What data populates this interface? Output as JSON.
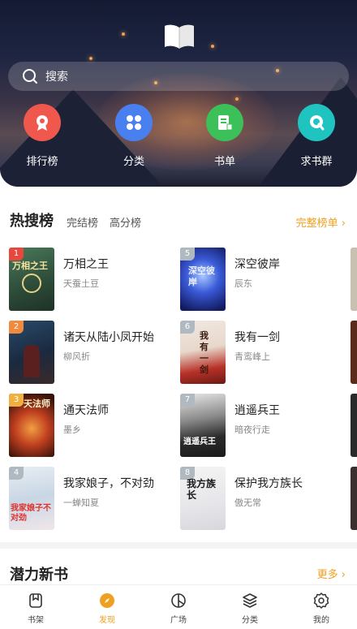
{
  "search": {
    "placeholder": "搜索"
  },
  "quick_links": [
    {
      "label": "排行榜",
      "icon": "ranking-badge-icon",
      "color": "#f0584e"
    },
    {
      "label": "分类",
      "icon": "category-grid-icon",
      "color": "#4a7ff0"
    },
    {
      "label": "书单",
      "icon": "booklist-icon",
      "color": "#3cc05a"
    },
    {
      "label": "求书群",
      "icon": "chat-bubble-icon",
      "color": "#1fc4c0"
    }
  ],
  "hot": {
    "title": "热搜榜",
    "tabs": [
      "完结榜",
      "高分榜"
    ],
    "more": "完整榜单 ›",
    "books": [
      {
        "rank": "1",
        "title": "万相之王",
        "author": "天蚕土豆"
      },
      {
        "rank": "2",
        "title": "诸天从陆小凤开始",
        "author": "柳风折"
      },
      {
        "rank": "3",
        "title": "通天法师",
        "author": "墨乡"
      },
      {
        "rank": "4",
        "title": "我家娘子，不对劲",
        "author": "一蝉知夏"
      },
      {
        "rank": "5",
        "title": "深空彼岸",
        "author": "辰东"
      },
      {
        "rank": "6",
        "title": "我有一剑",
        "author": "青鸾峰上"
      },
      {
        "rank": "7",
        "title": "逍遥兵王",
        "author": "暗夜行走"
      },
      {
        "rank": "8",
        "title": "保护我方族长",
        "author": "傲无常"
      }
    ],
    "cover_text": [
      "万相之王",
      "",
      "天法师",
      "我家娘子不对劲",
      "深空彼岸",
      "我有一剑",
      "逍遥兵王",
      "我方族长"
    ]
  },
  "potential": {
    "title": "潜力新书",
    "more": "更多 ›"
  },
  "nav": [
    {
      "label": "书架",
      "icon": "bookshelf-icon",
      "active": false
    },
    {
      "label": "发现",
      "icon": "compass-icon",
      "active": true
    },
    {
      "label": "广场",
      "icon": "plaza-icon",
      "active": false
    },
    {
      "label": "分类",
      "icon": "layers-icon",
      "active": false
    },
    {
      "label": "我的",
      "icon": "settings-gear-icon",
      "active": false
    }
  ],
  "colors": {
    "accent": "#f0a020"
  }
}
